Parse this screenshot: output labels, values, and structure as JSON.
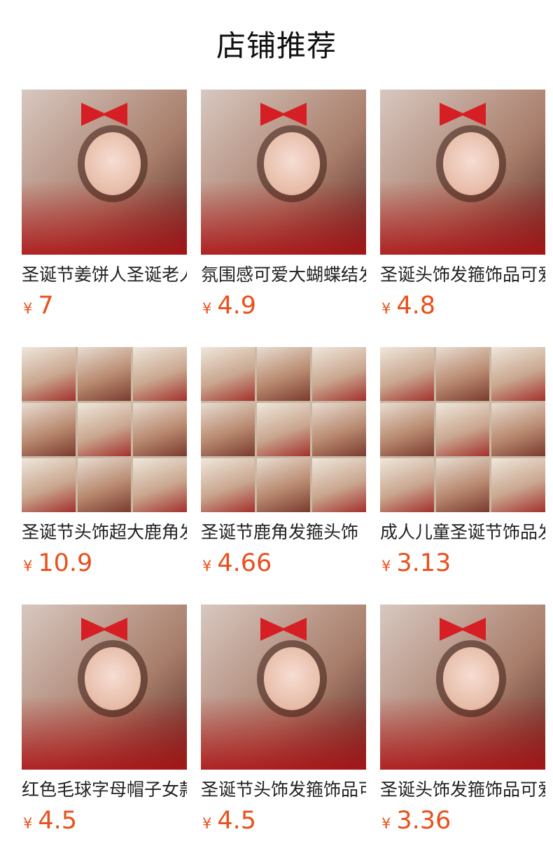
{
  "section_title": "店铺推荐",
  "currency_symbol": "¥",
  "accent_color": "#e8501c",
  "products": [
    {
      "name": "圣诞节姜饼人圣诞老人发箍",
      "price": "7",
      "image": "woman-with-teddy-bear-santa-headband-photo"
    },
    {
      "name": "氛围感可爱大蝴蝶结发箍",
      "price": "4.9",
      "image": "two-girls-with-sequin-bow-headbands-photo"
    },
    {
      "name": "圣诞头饰发箍饰品可爱",
      "price": "4.8",
      "image": "girl-with-red-antler-bow-headband-photo"
    },
    {
      "name": "圣诞节头饰超大鹿角发箍",
      "price": "10.9",
      "image": "reindeer-antler-headband-collage-photo"
    },
    {
      "name": "圣诞节鹿角发箍头饰",
      "price": "4.66",
      "image": "antler-hairclip-product-collage-photo"
    },
    {
      "name": "成人儿童圣诞节饰品发夹",
      "price": "3.13",
      "image": "christmas-hairclip-assortment-collage-photo"
    },
    {
      "name": "红色毛球字母帽子女款",
      "price": "4.5",
      "image": "woman-with-santa-hats-photo"
    },
    {
      "name": "圣诞节头饰发箍饰品可爱",
      "price": "4.5",
      "image": "two-girls-with-antler-bow-headbands-photo"
    },
    {
      "name": "圣诞头饰发箍饰品可爱",
      "price": "3.36",
      "image": "woman-with-mini-santa-hat-headband-photo"
    }
  ]
}
